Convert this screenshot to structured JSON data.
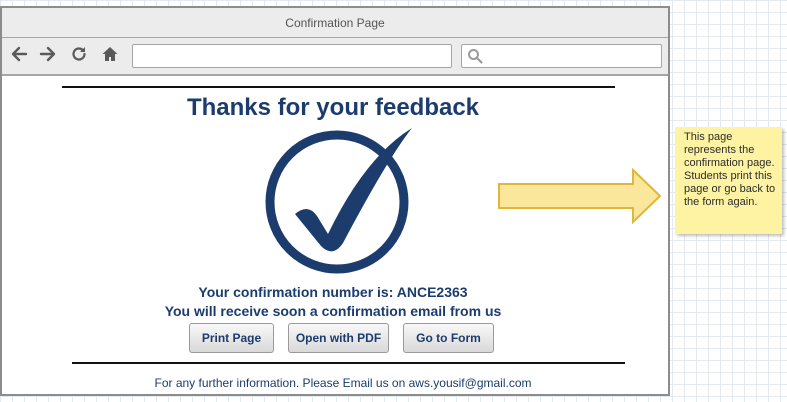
{
  "window": {
    "title": "Confirmation Page"
  },
  "nav": {
    "back_icon": "arrow-left-icon",
    "forward_icon": "arrow-right-icon",
    "reload_icon": "reload-icon",
    "home_icon": "home-icon",
    "search_icon": "magnifier-icon",
    "url_value": "",
    "search_value": ""
  },
  "page": {
    "heading": "Thanks for your feedback",
    "check_icon": "checkmark-circle-icon",
    "confirmation_text": "Your confirmation number is: ANCE2363",
    "email_notice": "You will receive soon a confirmation email from us",
    "buttons": {
      "print": "Print Page",
      "pdf": "Open with PDF",
      "form": "Go to Form"
    },
    "footer": "For any further information. Please Email us on aws.yousif@gmail.com"
  },
  "annotation": {
    "note": "This page represents the confirmation page. Students print this page or go back to the form again."
  },
  "colors": {
    "brand_navy": "#1c3c6e",
    "note_yellow": "#fdf3a2",
    "arrow_yellow": "#fbe79b"
  }
}
